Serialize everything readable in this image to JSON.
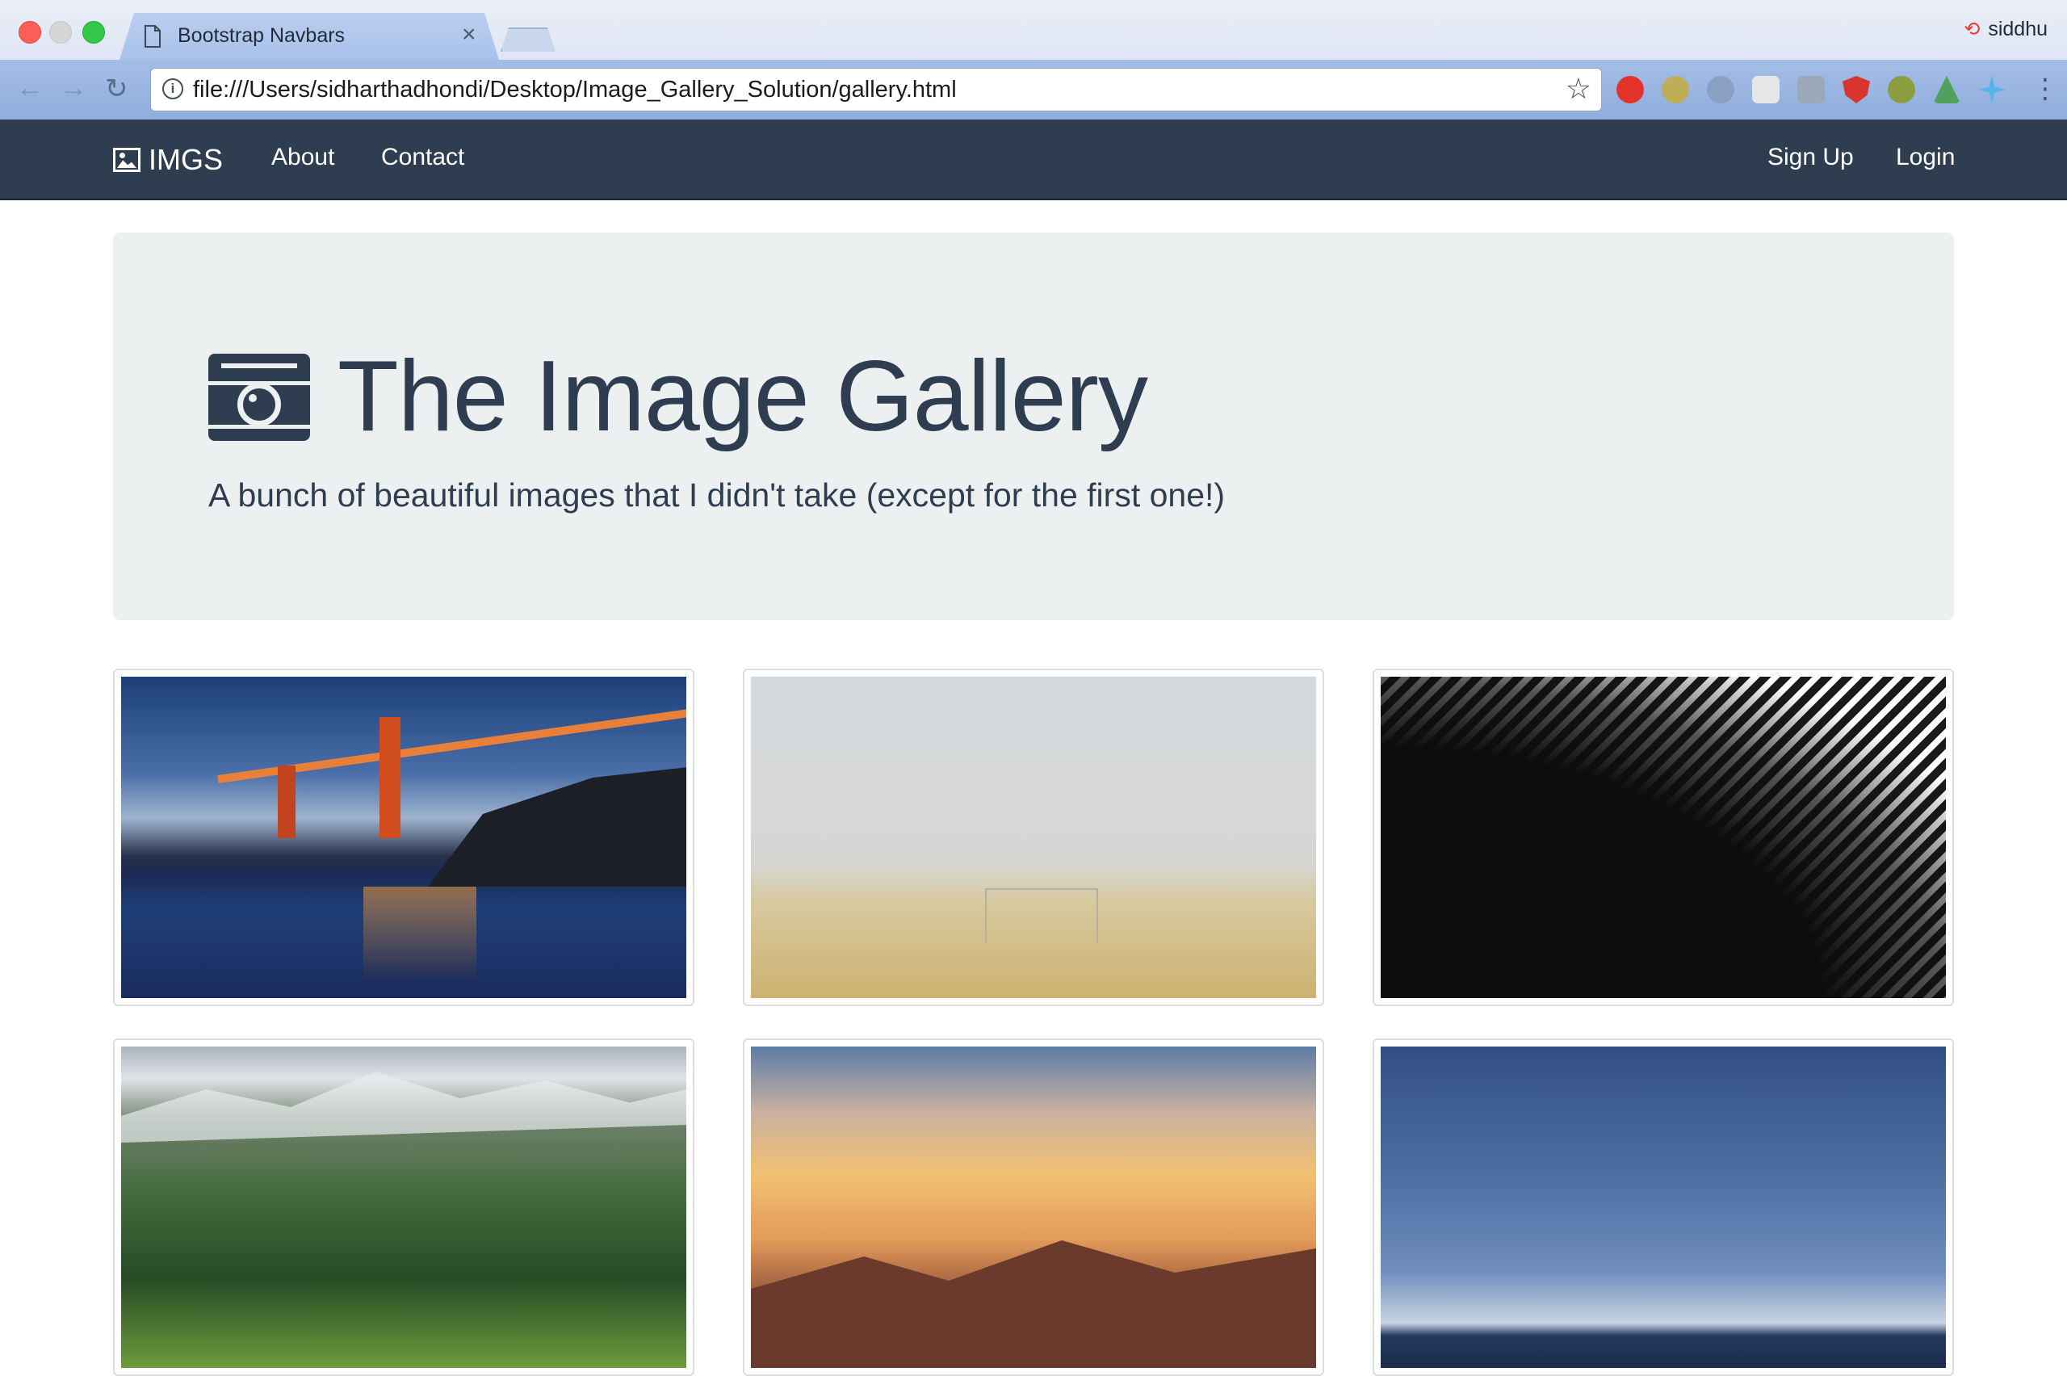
{
  "browser": {
    "tab_title": "Bootstrap Navbars",
    "tab_close": "×",
    "profile_name": "siddhu",
    "url": "file:///Users/sidharthadhondi/Desktop/Image_Gallery_Solution/gallery.html",
    "info_glyph": "i",
    "star_glyph": "☆",
    "back_glyph": "←",
    "forward_glyph": "→",
    "reload_glyph": "↻",
    "menu_glyph": "⋮"
  },
  "navbar": {
    "brand": "IMGS",
    "links": [
      "About",
      "Contact"
    ],
    "right_links": [
      "Sign Up",
      "Login"
    ],
    "bg_color": "#2e3d50"
  },
  "jumbotron": {
    "title": "The Image Gallery",
    "subtitle": "A bunch of beautiful images that I didn't take (except for the first one!)",
    "bg_color": "#ecf0f1"
  },
  "gallery": {
    "images": [
      {
        "scene": "golden-gate-bridge-at-dusk"
      },
      {
        "scene": "foggy-soccer-field"
      },
      {
        "scene": "black-white-architecture"
      },
      {
        "scene": "green-mountains-with-snow"
      },
      {
        "scene": "sunset-over-clouds-and-mountains"
      },
      {
        "scene": "blue-sky-over-sea"
      }
    ]
  }
}
